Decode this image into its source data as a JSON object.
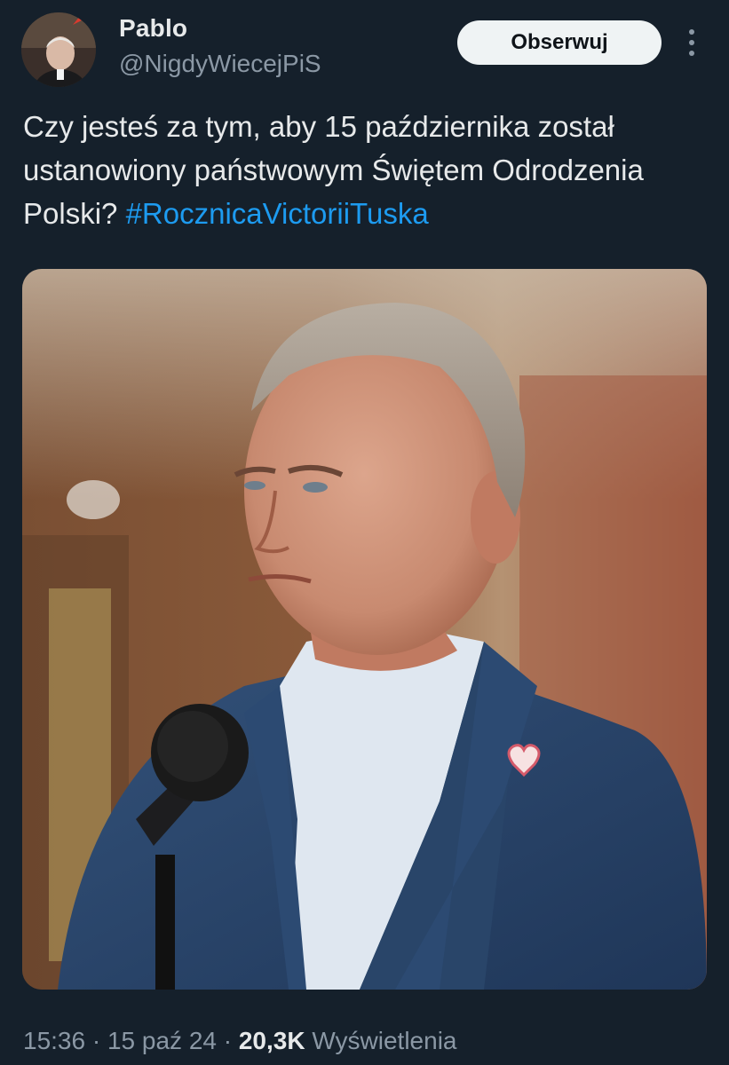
{
  "author": {
    "display_name": "Pablo",
    "handle": "@NigdyWiecejPiS"
  },
  "header": {
    "follow_label": "Obserwuj",
    "more_icon": "more-vertical-icon"
  },
  "tweet": {
    "text_before_hashtag": "Czy jesteś za tym, aby 15 października został ustanowiony państwowym Świętem Odrodzenia Polski? ",
    "hashtag": "#RocznicaVictoriiTuska"
  },
  "meta": {
    "time": "15:36",
    "separator": " · ",
    "date": "15 paź 24",
    "views_count": "20,3K",
    "views_label": " Wyświetlenia"
  },
  "colors": {
    "background": "#15202b",
    "text": "#e7e9ea",
    "secondary_text": "#8b98a5",
    "link": "#1d9bf0",
    "follow_button_bg": "#eff3f4"
  }
}
